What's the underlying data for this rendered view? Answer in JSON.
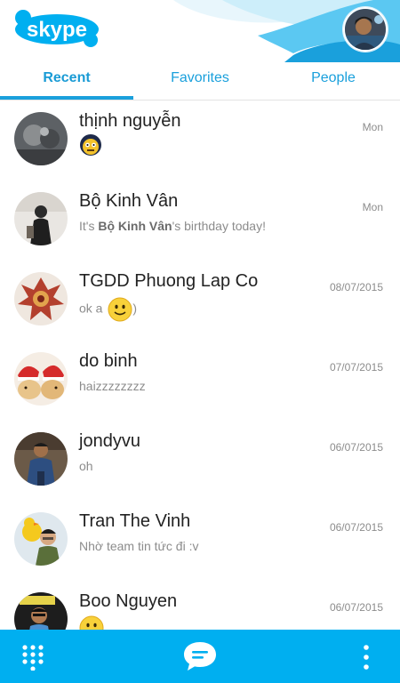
{
  "app": {
    "name": "skype"
  },
  "tabs": [
    {
      "label": "Recent",
      "active": true
    },
    {
      "label": "Favorites",
      "active": false
    },
    {
      "label": "People",
      "active": false
    }
  ],
  "conversations": [
    {
      "name": "thịnh nguyễn",
      "time": "Mon",
      "message": "",
      "emoji": "meme-face"
    },
    {
      "name": "Bộ Kinh Vân",
      "time": "Mon",
      "message_prefix": "It's ",
      "message_bold": "Bộ Kinh Vân",
      "message_suffix": "'s birthday today!"
    },
    {
      "name": "TGDD Phuong Lap Co",
      "time": "08/07/2015",
      "message": "ok a",
      "message_after": ")",
      "emoji": "smile"
    },
    {
      "name": "do binh",
      "time": "07/07/2015",
      "message": "haizzzzzzzz"
    },
    {
      "name": "jondyvu",
      "time": "06/07/2015",
      "message": "oh"
    },
    {
      "name": "Tran The Vinh",
      "time": "06/07/2015",
      "message": "Nhờ team tin tức đi :v"
    },
    {
      "name": "Boo Nguyen",
      "time": "06/07/2015",
      "message": "",
      "emoji": "smile"
    }
  ],
  "colors": {
    "accent": "#00aff0",
    "tab_text": "#1aa0dc",
    "secondary_text": "#8c8c8c"
  },
  "bottom_bar": {
    "icons": [
      "dialpad-icon",
      "chat-icon",
      "more-icon"
    ]
  }
}
